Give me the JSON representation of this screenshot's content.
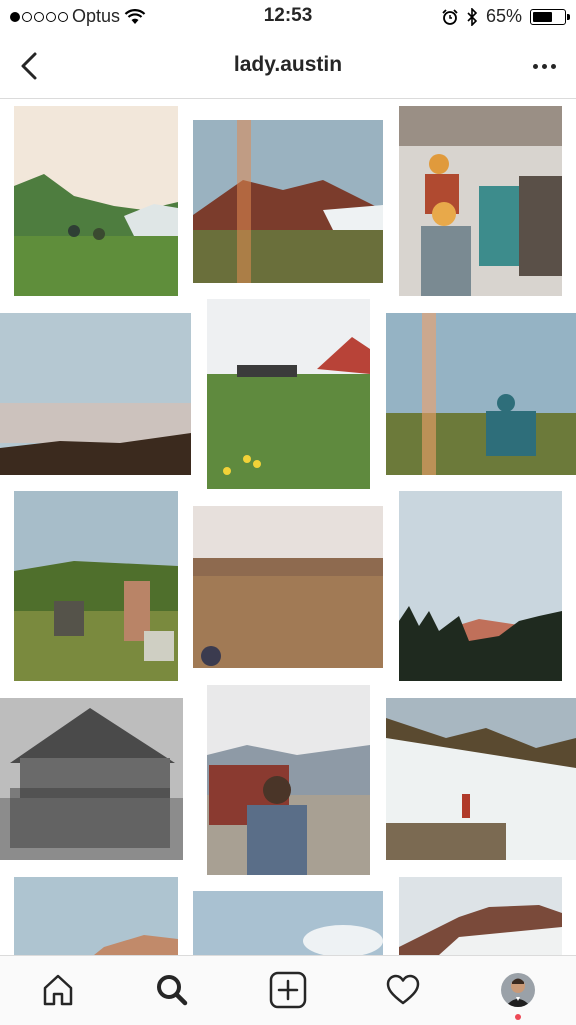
{
  "status_bar": {
    "carrier": "Optus",
    "time": "12:53",
    "battery": "65%",
    "battery_level": 0.65
  },
  "header": {
    "username": "lady.austin"
  },
  "icons": {
    "back": "chevron-left-icon",
    "more": "more-horizontal-icon",
    "tabs": [
      "home-icon",
      "search-icon",
      "add-post-icon",
      "heart-icon",
      "profile-avatar"
    ]
  },
  "colors": {
    "notification_dot": "#ed4956",
    "divider": "#dbdbdb"
  }
}
